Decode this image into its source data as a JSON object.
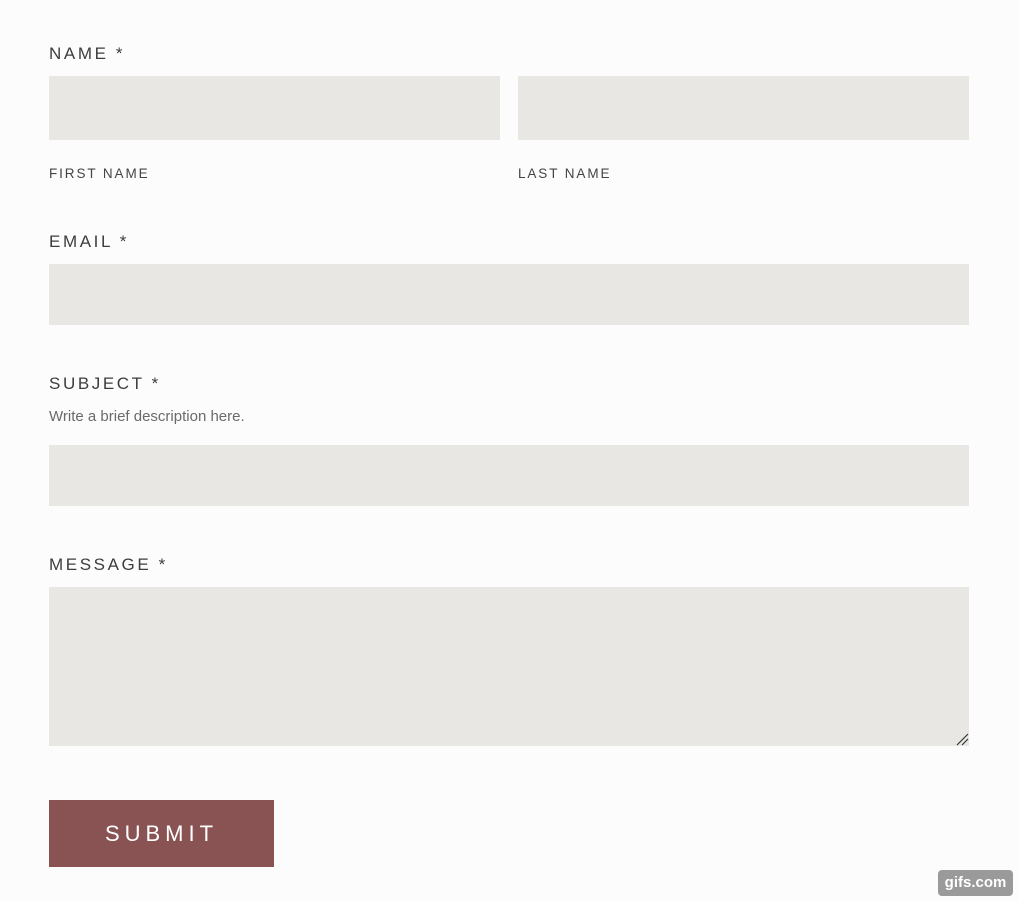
{
  "form": {
    "name": {
      "label": "NAME *",
      "first_name_label": "FIRST NAME",
      "last_name_label": "LAST NAME",
      "first_name_value": "",
      "last_name_value": ""
    },
    "email": {
      "label": "EMAIL *",
      "value": ""
    },
    "subject": {
      "label": "SUBJECT *",
      "help_text": "Write a brief description here.",
      "value": ""
    },
    "message": {
      "label": "MESSAGE *",
      "value": ""
    },
    "submit_label": "SUBMIT"
  },
  "watermark": "gifs.com",
  "colors": {
    "background": "#fcfcfc",
    "input_background": "#e9e7e4",
    "button_background": "#8a5353",
    "button_text": "#ffffff",
    "label_text": "#3d3d3d"
  },
  "icons": {
    "resize_handle": "resize-grip-icon"
  }
}
